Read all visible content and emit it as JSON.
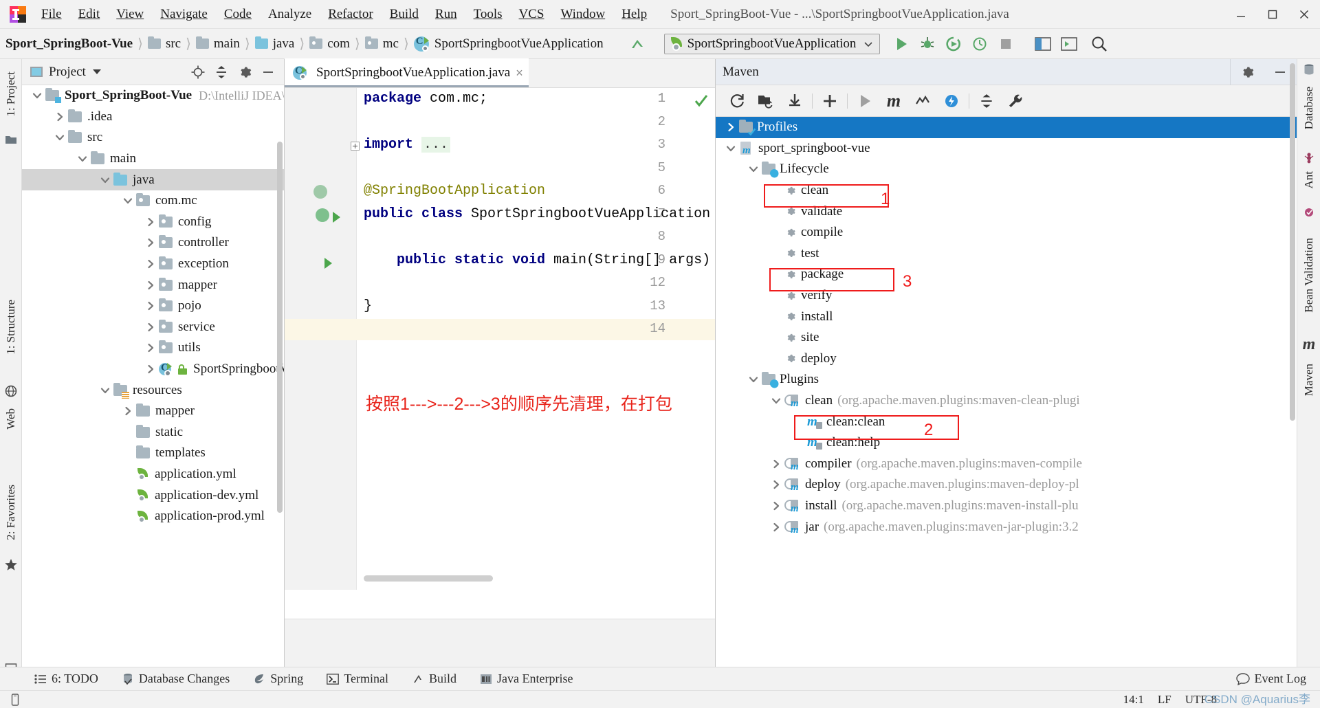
{
  "window": {
    "title": "Sport_SpringBoot-Vue - ...\\SportSpringbootVueApplication.java",
    "menus": [
      "File",
      "Edit",
      "View",
      "Navigate",
      "Code",
      "Analyze",
      "Refactor",
      "Build",
      "Run",
      "Tools",
      "VCS",
      "Window",
      "Help"
    ],
    "controls": {
      "minimize": "minimize-icon",
      "maximize": "maximize-icon",
      "close": "close-icon"
    }
  },
  "navbar": {
    "breadcrumbs": [
      {
        "label": "Sport_SpringBoot-Vue",
        "icon": "none"
      },
      {
        "label": "src",
        "icon": "folder"
      },
      {
        "label": "main",
        "icon": "folder"
      },
      {
        "label": "java",
        "icon": "folder-blue"
      },
      {
        "label": "com",
        "icon": "package"
      },
      {
        "label": "mc",
        "icon": "package"
      },
      {
        "label": "SportSpringbootVueApplication",
        "icon": "spring-class"
      }
    ],
    "run_config": "SportSpringbootVueApplication",
    "buttons": [
      "make-project-icon",
      "run-icon",
      "debug-icon",
      "run-coverage-icon",
      "profiler-icon",
      "stop-icon",
      "update-app-icon",
      "run-dashboard-icon",
      "search-icon"
    ]
  },
  "left_strip": [
    {
      "label": "1: Project"
    },
    {
      "label": "1: Structure"
    },
    {
      "label": "Web"
    },
    {
      "label": "2: Favorites"
    }
  ],
  "right_strip": [
    {
      "label": "Database"
    },
    {
      "label": "Ant"
    },
    {
      "label": "Bean Validation"
    },
    {
      "label": "Maven"
    }
  ],
  "project_panel": {
    "title": "Project",
    "actions": [
      "locate-icon",
      "collapse-all-icon",
      "settings-icon",
      "hide-icon"
    ],
    "tree": [
      {
        "depth": 0,
        "chevron": "down",
        "icon": "module-folder",
        "label": "Sport_SpringBoot-Vue",
        "bold": true,
        "path": "D:\\IntelliJ IDEA\\Id",
        "selected": false
      },
      {
        "depth": 1,
        "chevron": "right",
        "icon": "folder",
        "label": ".idea",
        "selected": false
      },
      {
        "depth": 1,
        "chevron": "down",
        "icon": "folder",
        "label": "src",
        "selected": false
      },
      {
        "depth": 2,
        "chevron": "down",
        "icon": "folder",
        "label": "main",
        "selected": false
      },
      {
        "depth": 3,
        "chevron": "down",
        "icon": "folder-blue",
        "label": "java",
        "selected": true
      },
      {
        "depth": 4,
        "chevron": "down",
        "icon": "package",
        "label": "com.mc",
        "selected": false
      },
      {
        "depth": 5,
        "chevron": "right",
        "icon": "package",
        "label": "config",
        "selected": false
      },
      {
        "depth": 5,
        "chevron": "right",
        "icon": "package",
        "label": "controller",
        "selected": false
      },
      {
        "depth": 5,
        "chevron": "right",
        "icon": "package",
        "label": "exception",
        "selected": false
      },
      {
        "depth": 5,
        "chevron": "right",
        "icon": "package",
        "label": "mapper",
        "selected": false
      },
      {
        "depth": 5,
        "chevron": "right",
        "icon": "package",
        "label": "pojo",
        "selected": false
      },
      {
        "depth": 5,
        "chevron": "right",
        "icon": "package",
        "label": "service",
        "selected": false
      },
      {
        "depth": 5,
        "chevron": "right",
        "icon": "package",
        "label": "utils",
        "selected": false
      },
      {
        "depth": 5,
        "chevron": "right",
        "icon": "spring-class",
        "label": "SportSpringbootVu",
        "selected": false
      },
      {
        "depth": 3,
        "chevron": "down",
        "icon": "resources-folder",
        "label": "resources",
        "selected": false
      },
      {
        "depth": 4,
        "chevron": "right",
        "icon": "folder",
        "label": "mapper",
        "selected": false
      },
      {
        "depth": 4,
        "chevron": "none",
        "icon": "folder",
        "label": "static",
        "selected": false
      },
      {
        "depth": 4,
        "chevron": "none",
        "icon": "folder",
        "label": "templates",
        "selected": false
      },
      {
        "depth": 4,
        "chevron": "none",
        "icon": "yml",
        "label": "application.yml",
        "selected": false
      },
      {
        "depth": 4,
        "chevron": "none",
        "icon": "yml",
        "label": "application-dev.yml",
        "selected": false
      },
      {
        "depth": 4,
        "chevron": "none",
        "icon": "yml",
        "label": "application-prod.yml",
        "selected": false
      }
    ]
  },
  "editor": {
    "tab": {
      "label": "SportSpringbootVueApplication.java",
      "close": "×",
      "icon": "spring-class-icon"
    },
    "inspection_status": "checkmark-ok",
    "lines": [
      {
        "num": "1",
        "segments": [
          {
            "t": "package ",
            "c": "kw"
          },
          {
            "t": "com.mc;",
            "c": "pl"
          }
        ]
      },
      {
        "num": "2",
        "segments": []
      },
      {
        "num": "3",
        "segments": [
          {
            "t": "import ",
            "c": "kw"
          },
          {
            "t": "...",
            "c": "ell"
          }
        ],
        "fold": true
      },
      {
        "num": "5",
        "segments": []
      },
      {
        "num": "6",
        "segments": [
          {
            "t": "@SpringBootApplication",
            "c": "ann"
          }
        ],
        "gutter": "spring-bean-icon"
      },
      {
        "num": "7",
        "segments": [
          {
            "t": "public class ",
            "c": "kw"
          },
          {
            "t": "SportSpringbootVueApplication {",
            "c": "pl"
          }
        ],
        "gutter": "spring-run-icon"
      },
      {
        "num": "8",
        "segments": []
      },
      {
        "num": "9",
        "segments": [
          {
            "t": "    public static void ",
            "c": "kw"
          },
          {
            "t": "main(String[] args) {",
            "c": "pl"
          }
        ],
        "gutter": "run-icon"
      },
      {
        "num": "12",
        "segments": []
      },
      {
        "num": "13",
        "segments": [
          {
            "t": "}",
            "c": "pl"
          }
        ]
      },
      {
        "num": "14",
        "segments": [],
        "current": true
      }
    ],
    "annotation": "按照1--->---2--->3的顺序先清理，在打包"
  },
  "maven": {
    "title": "Maven",
    "toolbar": [
      "reimport-icon",
      "generate-sources-icon",
      "download-sources-icon",
      "add-maven-project-icon",
      "run-icon",
      "execute-goal-icon",
      "toggle-skip-tests-icon",
      "toggle-offline-icon",
      "collapse-all-icon",
      "settings-icon"
    ],
    "tree": [
      {
        "depth": 0,
        "chevron": "right",
        "icon": "profiles-folder",
        "label": "Profiles",
        "selected": true
      },
      {
        "depth": 0,
        "chevron": "down",
        "icon": "pom",
        "label": "sport_springboot-vue"
      },
      {
        "depth": 1,
        "chevron": "down",
        "icon": "config-folder",
        "label": "Lifecycle"
      },
      {
        "depth": 2,
        "chevron": "none",
        "icon": "gear",
        "label": "clean"
      },
      {
        "depth": 2,
        "chevron": "none",
        "icon": "gear",
        "label": "validate"
      },
      {
        "depth": 2,
        "chevron": "none",
        "icon": "gear",
        "label": "compile"
      },
      {
        "depth": 2,
        "chevron": "none",
        "icon": "gear",
        "label": "test"
      },
      {
        "depth": 2,
        "chevron": "none",
        "icon": "gear",
        "label": "package"
      },
      {
        "depth": 2,
        "chevron": "none",
        "icon": "gear",
        "label": "verify"
      },
      {
        "depth": 2,
        "chevron": "none",
        "icon": "gear",
        "label": "install"
      },
      {
        "depth": 2,
        "chevron": "none",
        "icon": "gear",
        "label": "site"
      },
      {
        "depth": 2,
        "chevron": "none",
        "icon": "gear",
        "label": "deploy"
      },
      {
        "depth": 1,
        "chevron": "down",
        "icon": "config-folder",
        "label": "Plugins"
      },
      {
        "depth": 2,
        "chevron": "down",
        "icon": "plugin",
        "label": "clean",
        "suffix": "(org.apache.maven.plugins:maven-clean-plugi"
      },
      {
        "depth": 3,
        "chevron": "none",
        "icon": "goal",
        "label": "clean:clean"
      },
      {
        "depth": 3,
        "chevron": "none",
        "icon": "goal",
        "label": "clean:help"
      },
      {
        "depth": 2,
        "chevron": "right",
        "icon": "plugin",
        "label": "compiler",
        "suffix": "(org.apache.maven.plugins:maven-compile"
      },
      {
        "depth": 2,
        "chevron": "right",
        "icon": "plugin",
        "label": "deploy",
        "suffix": "(org.apache.maven.plugins:maven-deploy-pl"
      },
      {
        "depth": 2,
        "chevron": "right",
        "icon": "plugin",
        "label": "install",
        "suffix": "(org.apache.maven.plugins:maven-install-plu"
      },
      {
        "depth": 2,
        "chevron": "right",
        "icon": "plugin",
        "label": "jar",
        "suffix": "(org.apache.maven.plugins:maven-jar-plugin:3.2"
      }
    ],
    "callouts": [
      {
        "number": "1",
        "target": "clean"
      },
      {
        "number": "3",
        "target": "package"
      },
      {
        "number": "2",
        "target": "clean:clean"
      }
    ]
  },
  "bottom_bar": {
    "items": [
      {
        "label": "6: TODO",
        "icon": "todo-icon",
        "mnemonic": "6"
      },
      {
        "label": "Database Changes",
        "icon": "database-changes-icon"
      },
      {
        "label": "Spring",
        "icon": "spring-icon"
      },
      {
        "label": "Terminal",
        "icon": "terminal-icon"
      },
      {
        "label": "Build",
        "icon": "build-icon"
      },
      {
        "label": "Java Enterprise",
        "icon": "java-enterprise-icon"
      }
    ],
    "event_log": "Event Log"
  },
  "status_bar": {
    "caret": "14:1",
    "line_separator": "LF",
    "encoding": "UTF-8",
    "watermark": "CSDN @Aquarius李",
    "memory_icon": "device-icon"
  },
  "colors": {
    "accent_blue": "#1577c4",
    "red_callout": "#ef1b1b",
    "keyword": "#000080",
    "annotation": "#808000",
    "spring_green": "#6db33f",
    "folder_grey": "#a9b7c0",
    "folder_blue": "#7bc3dd",
    "selection_grey": "#d4d4d4",
    "current_line": "#fcf7e6"
  }
}
